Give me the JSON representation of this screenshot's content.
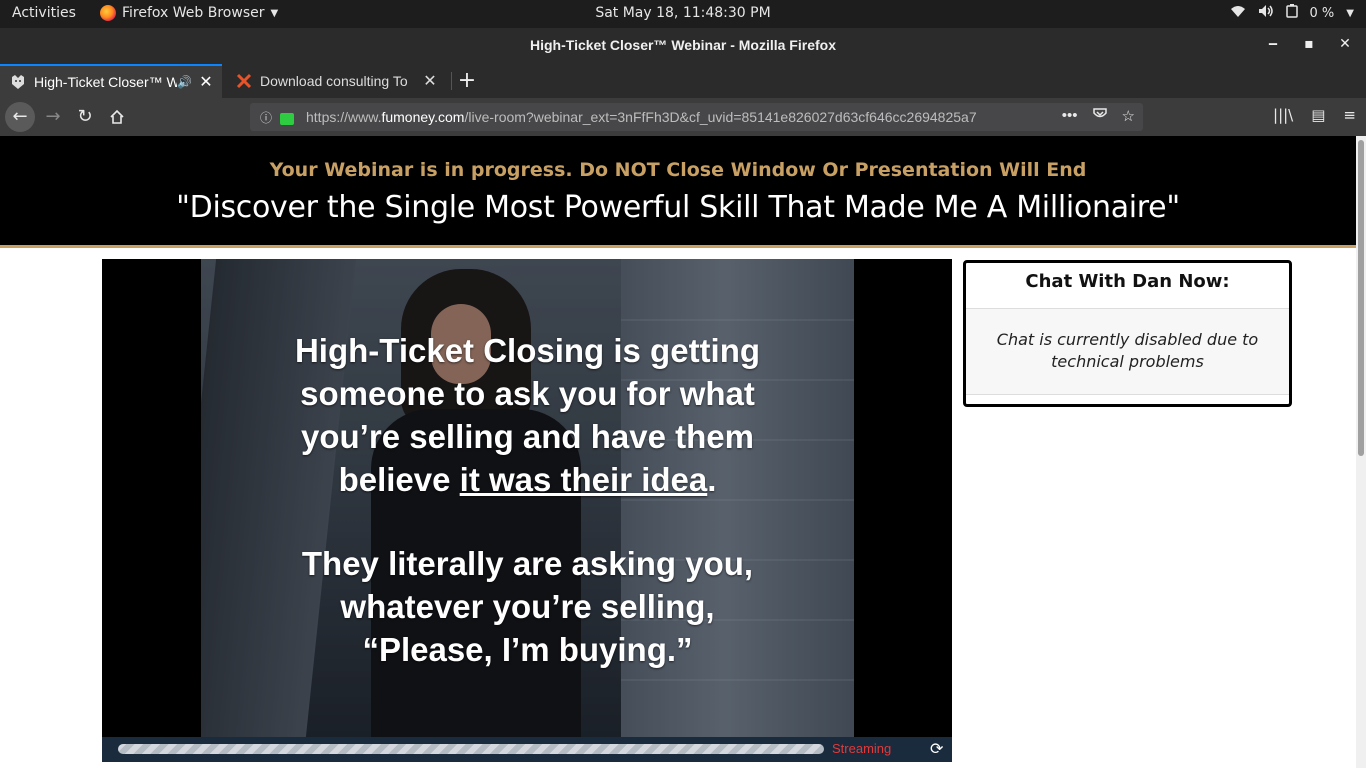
{
  "system": {
    "activities": "Activities",
    "app_menu": "Firefox Web Browser",
    "clock": "Sat May 18, 11:48:30 PM",
    "battery": "0 %"
  },
  "window": {
    "title": "High-Ticket Closer™ Webinar - Mozilla Firefox"
  },
  "tabs": [
    {
      "label": "High-Ticket Closer™ W",
      "favicon": "panther-icon",
      "active": true
    },
    {
      "label": "Download consulting To",
      "favicon": "x-icon",
      "active": false
    }
  ],
  "url": {
    "prefix": "https://www.",
    "domain": "fumoney.com",
    "path": "/live-room?webinar_ext=3nFfFh3D&cf_uvid=85141e826027d63cf646cc2694825a7"
  },
  "page": {
    "notice": "Your Webinar is in progress. Do NOT Close Window Or Presentation Will End",
    "title": "\"Discover the Single Most Powerful Skill That Made Me A Millionaire\""
  },
  "slide": {
    "line1": "High-Ticket Closing is getting",
    "line2": "someone to ask you for what",
    "line3": "you’re selling and have them",
    "line4_a": "believe ",
    "line4_u": "it was their idea",
    "line4_b": ".",
    "line5": "They literally are asking you,",
    "line6": "whatever you’re selling,",
    "line7": "“Please, I’m buying.”"
  },
  "player": {
    "status": "Streaming"
  },
  "chat": {
    "heading": "Chat With Dan Now:",
    "message": "Chat is currently disabled due to technical problems"
  }
}
